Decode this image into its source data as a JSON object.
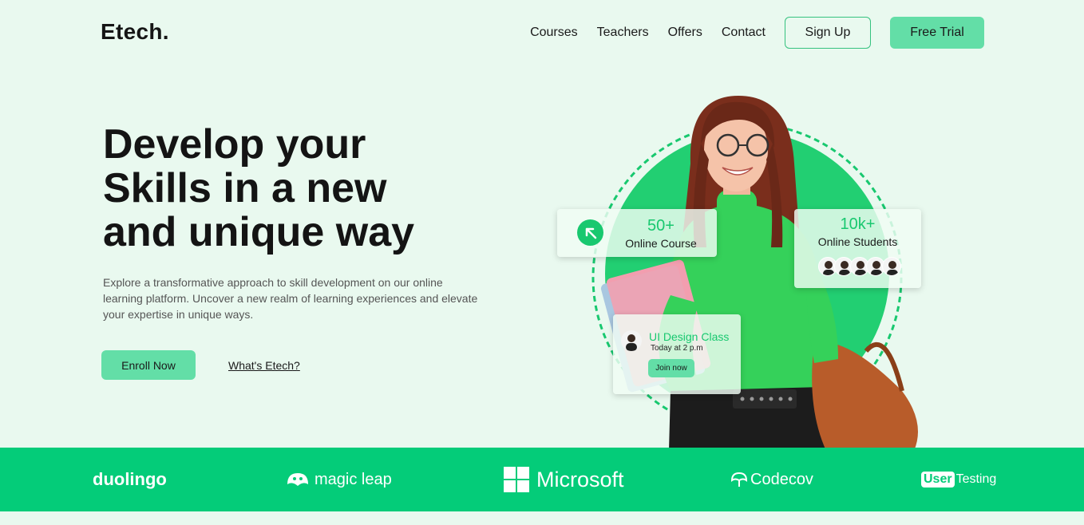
{
  "brand": {
    "logo": "Etech."
  },
  "nav": {
    "links": [
      "Courses",
      "Teachers",
      "Offers",
      "Contact"
    ],
    "signup_label": "Sign Up",
    "trial_label": "Free Trial"
  },
  "hero": {
    "title": "Develop your Skills in a new and unique way",
    "description": "Explore a transformative approach to skill development on our online learning platform. Uncover a new realm of learning experiences and elevate your expertise in unique ways.",
    "enroll_label": "Enroll Now",
    "whats_label": "What's Etech?"
  },
  "stats": {
    "courses": {
      "value": "50+",
      "label": "Online Course"
    },
    "students": {
      "value": "10k+",
      "label": "Online Students"
    }
  },
  "class_card": {
    "title": "UI Design Class",
    "time": "Today at 2 p.m",
    "join_label": "Join now"
  },
  "partners": {
    "duolingo": "duolingo",
    "magicleap": "magic leap",
    "microsoft": "Microsoft",
    "codecov": "Codecov",
    "usertesting_user": "User",
    "usertesting_testing": "Testing"
  },
  "colors": {
    "accent": "#04cc79",
    "accent_light": "#63dea7",
    "background": "#e9f9ef"
  }
}
